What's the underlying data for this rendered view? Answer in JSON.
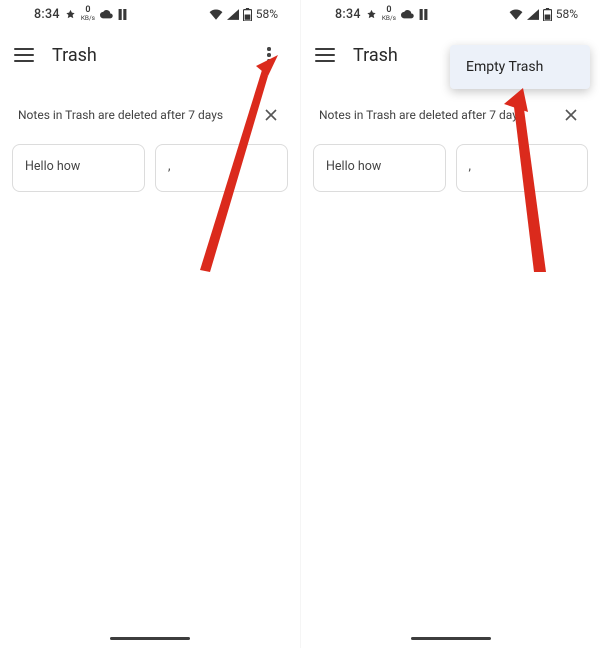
{
  "status": {
    "time": "8:34",
    "net_kbps_value": "0",
    "net_kbps_unit": "KB/s",
    "battery_pct": "58%"
  },
  "appbar": {
    "title": "Trash"
  },
  "banner": {
    "text": "Notes in Trash are deleted after 7 days"
  },
  "notes": [
    {
      "text": "Hello how"
    },
    {
      "text": ","
    }
  ],
  "menu": {
    "empty_trash": "Empty Trash"
  }
}
